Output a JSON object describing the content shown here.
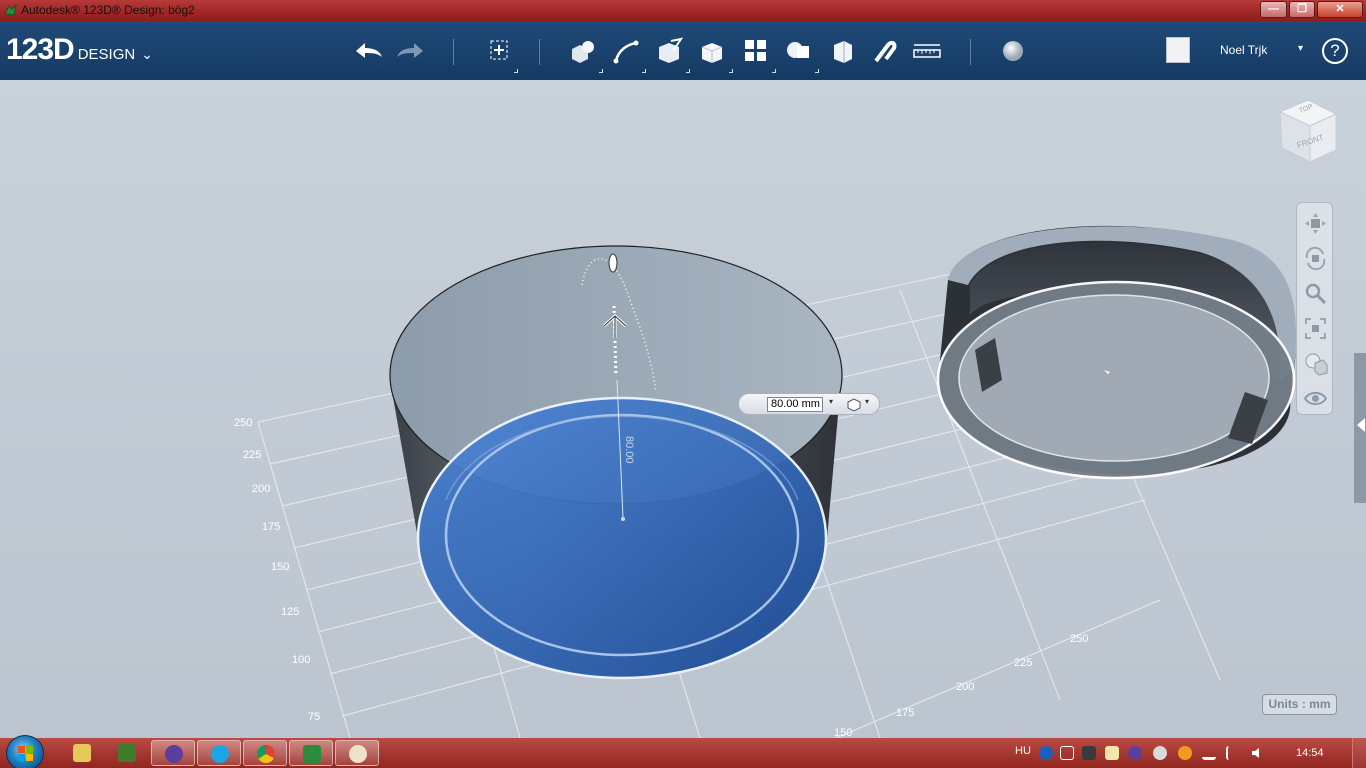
{
  "window": {
    "title": "Autodesk® 123D® Design: bög2",
    "minimize": "—",
    "maximize": "❐",
    "close": "✕"
  },
  "appbar": {
    "logo_main": "123D",
    "logo_sub": "DESIGN",
    "logo_chevron": "⌄",
    "user_name": "Noel Trjk",
    "user_dropdown": "▾",
    "help": "?"
  },
  "toolbar": {
    "icons": [
      "undo-icon",
      "redo-icon",
      "transform-icon",
      "primitives-icon",
      "sketch-icon",
      "construct-icon",
      "modify-icon",
      "pattern-icon",
      "grouping-icon",
      "combine-icon",
      "measure-icon",
      "snap-icon",
      "ruler-icon",
      "material-icon"
    ]
  },
  "viewport": {
    "dimension_value": "80.00 mm",
    "dimension_dropdown": "▾",
    "dimension_dropdown2": "▾",
    "inline_dim_label": "80.00",
    "units_label": "Units : mm",
    "viewcube_top": "TOP",
    "viewcube_front": "FRONT",
    "grid_labels_left": [
      "250",
      "225",
      "200",
      "175",
      "150",
      "125",
      "100",
      "75"
    ],
    "grid_labels_bottom": [
      "150",
      "175",
      "200",
      "225",
      "250"
    ]
  },
  "navbar": {
    "icons": [
      "pan-icon",
      "orbit-icon",
      "zoom-icon",
      "fit-icon",
      "view-style-icon",
      "visibility-icon"
    ]
  },
  "taskbar": {
    "language": "HU",
    "clock": "14:54",
    "apps": [
      "explorer",
      "minecraft",
      "rival-app",
      "skype",
      "chrome",
      "123d-design",
      "paint"
    ]
  },
  "colors": {
    "titlebar": "#a02626",
    "appbar": "#1b4371",
    "viewport": "#c4ccd6",
    "selection_blue": "#3d74c9",
    "taskbar": "#a4332c"
  }
}
